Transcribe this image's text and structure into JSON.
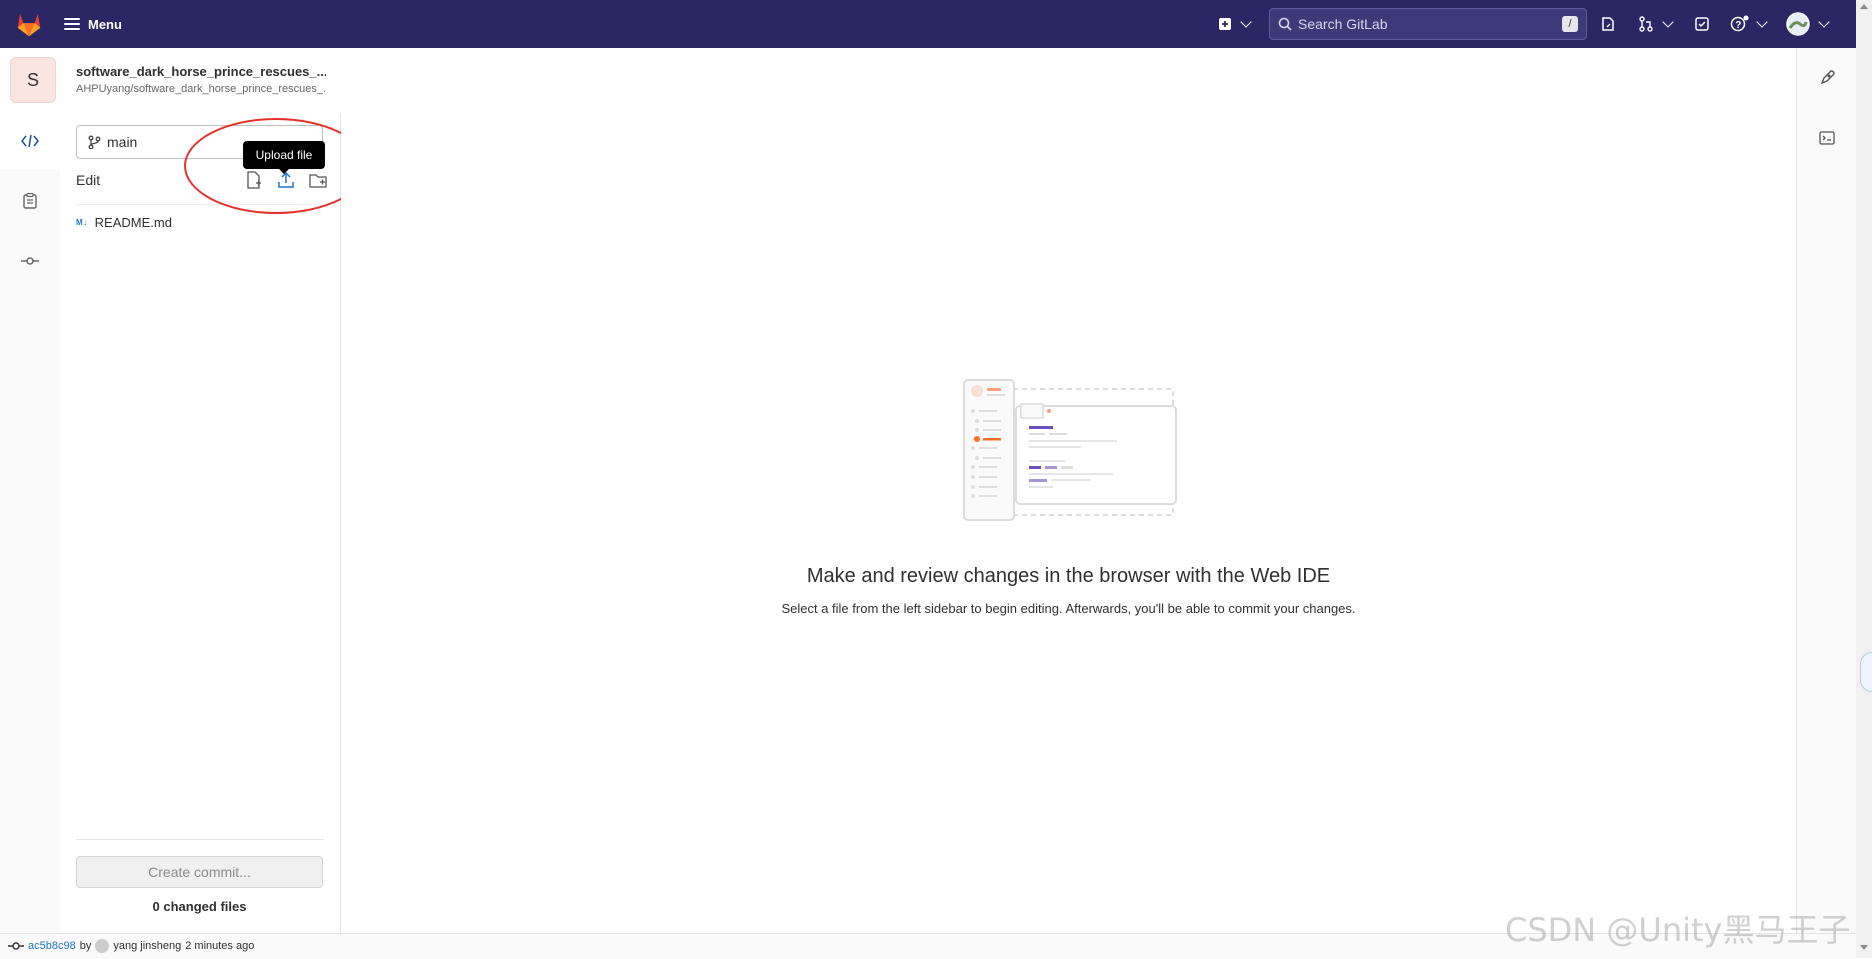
{
  "nav": {
    "menu_label": "Menu",
    "search_placeholder": "Search GitLab",
    "search_shortcut": "/"
  },
  "project": {
    "avatar_letter": "S",
    "name": "software_dark_horse_prince_rescues_...",
    "path": "AHPUyang/software_dark_horse_prince_rescues_..."
  },
  "file_panel": {
    "branch": "main",
    "edit_label": "Edit",
    "tooltip": "Upload file",
    "files": [
      {
        "badge": "M↓",
        "name": "README.md"
      }
    ],
    "commit_button": "Create commit...",
    "changed_files": "0 changed files"
  },
  "main": {
    "title": "Make and review changes in the browser with the Web IDE",
    "subtitle": "Select a file from the left sidebar to begin editing. Afterwards, you'll be able to commit your changes."
  },
  "status": {
    "commit_hash": "ac5b8c98",
    "by": "by",
    "author": "yang jinsheng",
    "time": "2 minutes ago"
  },
  "watermark": "CSDN @Unity黑马王子",
  "colors": {
    "nav_bg": "#2b2765",
    "accent_blue": "#1f75cb",
    "annotation_red": "#e5312a"
  }
}
